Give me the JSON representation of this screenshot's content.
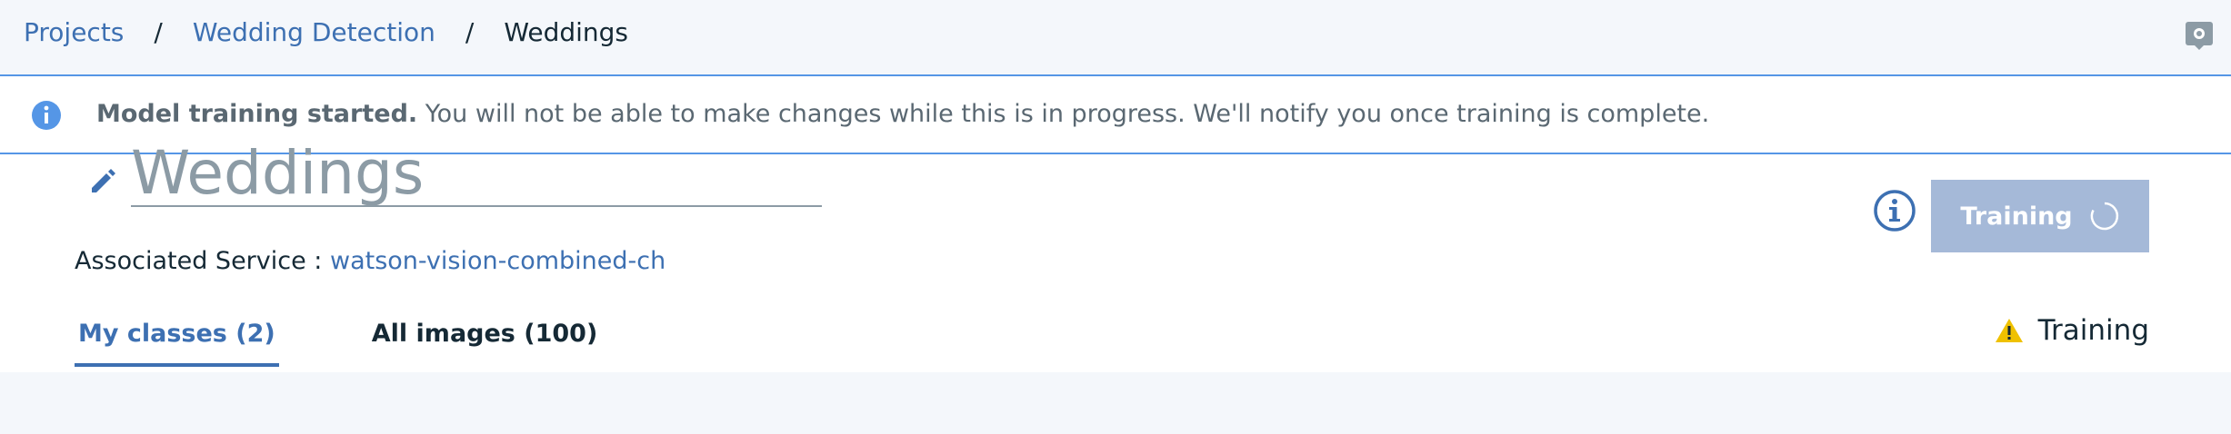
{
  "breadcrumb": {
    "items": [
      "Projects",
      "Wedding Detection"
    ],
    "separator": "/",
    "current": "Weddings"
  },
  "header": {
    "settings_icon": "gear-box-icon"
  },
  "notification": {
    "icon": "info-icon",
    "title": "Model training started.",
    "message": "You will not be able to make changes while this is in progress. We'll notify you once training is complete."
  },
  "model": {
    "name": "Weddings",
    "associated_service_label": "Associated Service :",
    "associated_service_value": "watson-vision-combined-ch"
  },
  "actions": {
    "train_label": "Training",
    "info_icon": "info-circle-icon"
  },
  "tabs": [
    {
      "label": "My classes (2)",
      "active": true
    },
    {
      "label": "All images (100)",
      "active": false
    }
  ],
  "status": {
    "label": "Training",
    "icon": "warning-icon"
  },
  "colors": {
    "accent": "#3d70b2",
    "info": "#5596e6",
    "button_disabled": "#a5b9d8",
    "warning": "#efc100",
    "background": "#f4f7fb"
  }
}
